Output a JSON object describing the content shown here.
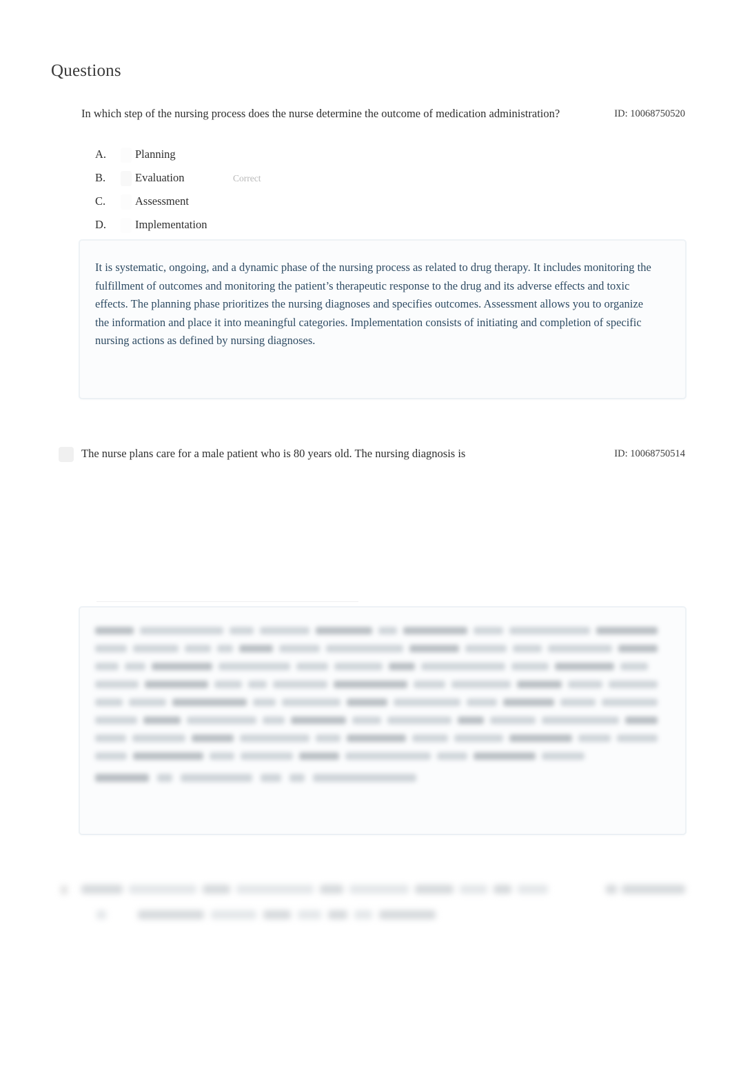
{
  "document": {
    "title": "Questions"
  },
  "questions": [
    {
      "id_label": "ID: 10068750520",
      "stem": "In which step of the nursing process does the nurse determine the outcome of medication administration?",
      "options": [
        {
          "letter": "A.",
          "text": "Planning",
          "flag": ""
        },
        {
          "letter": "B.",
          "text": "Evaluation",
          "flag": "Correct"
        },
        {
          "letter": "C.",
          "text": "Assessment",
          "flag": ""
        },
        {
          "letter": "D.",
          "text": "Implementation",
          "flag": ""
        }
      ],
      "rationale": "It is systematic, ongoing, and a dynamic phase of the nursing process as related to drug therapy. It includes monitoring the fulfillment of outcomes and monitoring the patient’s therapeutic response to the drug and its adverse effects and toxic effects. The planning phase prioritizes the nursing diagnoses and specifies outcomes. Assessment allows you to organize the information and place it into meaningful categories. Implementation consists of initiating and completion of specific nursing actions as defined by nursing diagnoses."
    },
    {
      "id_label": "ID: 10068750514",
      "stem": "The nurse plans care for a male patient who is 80 years old. The nursing diagnosis is",
      "options": [],
      "rationale": ""
    },
    {
      "id_label": "",
      "stem": "",
      "options": [],
      "rationale": ""
    }
  ]
}
